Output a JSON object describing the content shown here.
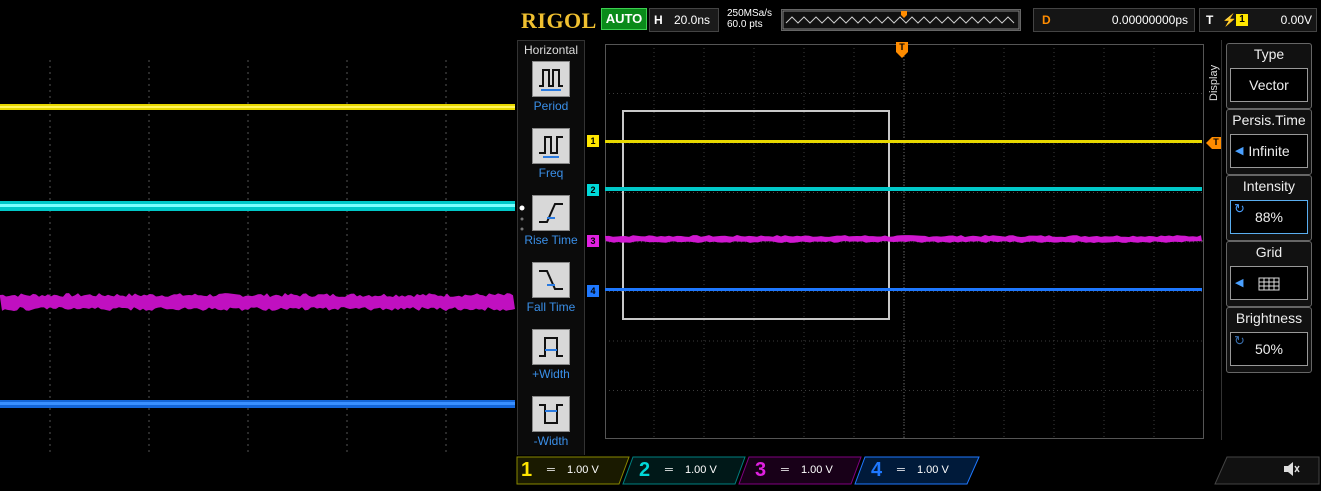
{
  "brand": "RIGOL",
  "run_status": "AUTO",
  "horizontal": {
    "key": "H",
    "timebase": "20.0ns",
    "sample_rate": "250MSa/s",
    "points": "60.0 pts"
  },
  "delay": {
    "key": "D",
    "value": "0.00000000ps"
  },
  "trigger": {
    "key": "T",
    "slope_symbol": "⚡",
    "source": "1",
    "level": "0.00V"
  },
  "menu": {
    "title": "Horizontal",
    "items": [
      {
        "label": "Period",
        "icon": "period-icon"
      },
      {
        "label": "Freq",
        "icon": "frequency-icon"
      },
      {
        "label": "Rise Time",
        "icon": "rise-time-icon"
      },
      {
        "label": "Fall Time",
        "icon": "fall-time-icon"
      },
      {
        "label": "+Width",
        "icon": "positive-width-icon"
      },
      {
        "label": "-Width",
        "icon": "negative-width-icon"
      }
    ]
  },
  "display_menu": {
    "title": "Display",
    "items": [
      {
        "title": "Type",
        "value": "Vector"
      },
      {
        "title": "Persis.Time",
        "value": "Infinite"
      },
      {
        "title": "Intensity",
        "value": "88%"
      },
      {
        "title": "Grid",
        "value": "grid-icon"
      },
      {
        "title": "Brightness",
        "value": "50%"
      }
    ]
  },
  "channels": [
    {
      "number": "1",
      "coupling": "═",
      "scale": "1.00 V",
      "color": "#ffe600"
    },
    {
      "number": "2",
      "coupling": "═",
      "scale": "1.00 V",
      "color": "#00d8d8"
    },
    {
      "number": "3",
      "coupling": "═",
      "scale": "1.00 V",
      "color": "#e020e0"
    },
    {
      "number": "4",
      "coupling": "═",
      "scale": "1.00 V",
      "color": "#1e78ff"
    }
  ],
  "trace_markers": [
    "1",
    "2",
    "3",
    "4"
  ],
  "trigger_marker": "T",
  "colors": {
    "accent": "#3a8fe8",
    "brand": "#f0c030",
    "run": "#0a8a1a",
    "delay_key": "#ff8c00"
  }
}
